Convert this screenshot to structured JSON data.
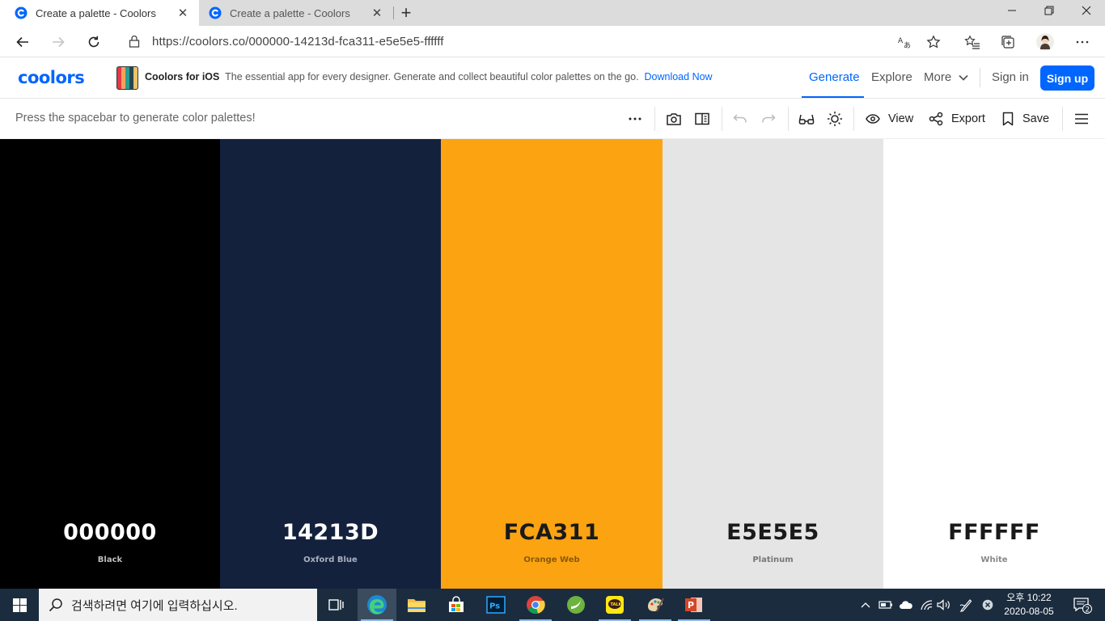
{
  "browser": {
    "tabs": [
      {
        "title": "Create a palette - Coolors",
        "active": true
      },
      {
        "title": "Create a palette - Coolors",
        "active": false
      }
    ],
    "url": "https://coolors.co/000000-14213d-fca311-e5e5e5-ffffff"
  },
  "header": {
    "logo": "coolors",
    "promo_title": "Coolors for iOS",
    "promo_text": "The essential app for every designer. Generate and collect beautiful color palettes on the go.",
    "promo_link": "Download Now",
    "nav": {
      "generate": "Generate",
      "explore": "Explore",
      "more": "More",
      "signin": "Sign in",
      "signup": "Sign up"
    }
  },
  "toolbar": {
    "hint": "Press the spacebar to generate color palettes!",
    "view_label": "View",
    "export_label": "Export",
    "save_label": "Save"
  },
  "palette": [
    {
      "hex": "000000",
      "name": "Black",
      "color": "#000000",
      "text_color": "#ffffff",
      "name_color": "#bdbdbd"
    },
    {
      "hex": "14213D",
      "name": "Oxford Blue",
      "color": "#14213d",
      "text_color": "#ffffff",
      "name_color": "#a9b0bf"
    },
    {
      "hex": "FCA311",
      "name": "Orange Web",
      "color": "#fca311",
      "text_color": "#1a1a1a",
      "name_color": "#8a5a07"
    },
    {
      "hex": "E5E5E5",
      "name": "Platinum",
      "color": "#e5e5e5",
      "text_color": "#1a1a1a",
      "name_color": "#777777"
    },
    {
      "hex": "FFFFFF",
      "name": "White",
      "color": "#ffffff",
      "text_color": "#1a1a1a",
      "name_color": "#888888"
    }
  ],
  "taskbar": {
    "search_placeholder": "검색하려면 여기에 입력하십시오.",
    "time_period": "오후 10:22",
    "date": "2020-08-05",
    "notification_count": "2",
    "apps": [
      "task-view-icon",
      "edge-icon",
      "file-explorer-icon",
      "microsoft-store-icon",
      "photoshop-icon",
      "chrome-icon",
      "spring-tool-icon",
      "kakaotalk-icon",
      "paint-icon",
      "powerpoint-icon"
    ]
  },
  "colors": {
    "brand": "#0066ff",
    "taskbar": "#1b2c3f"
  }
}
